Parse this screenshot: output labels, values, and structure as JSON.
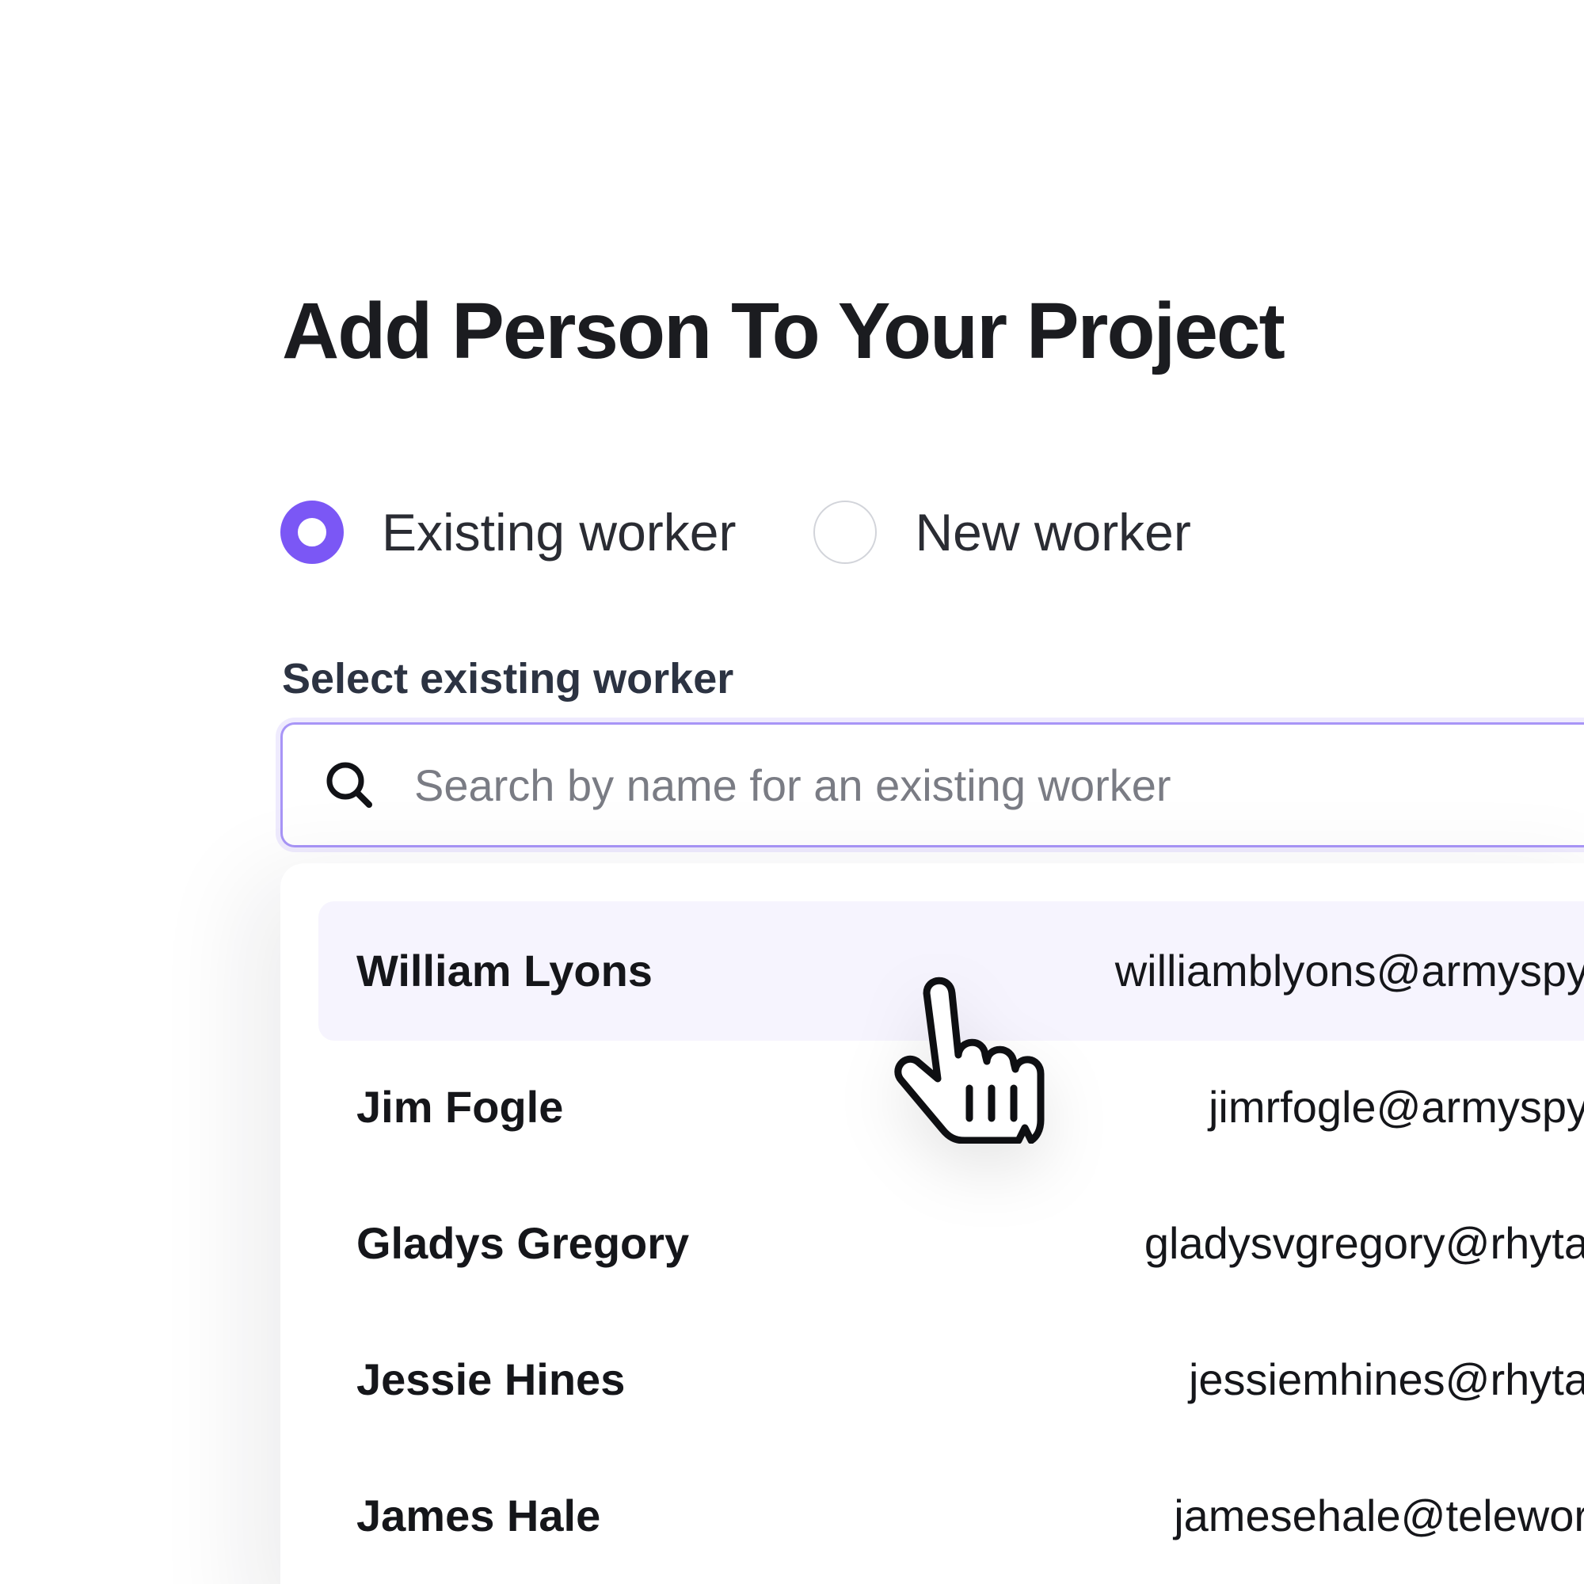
{
  "dialog": {
    "title": "Add Person To Your Project"
  },
  "worker_type": {
    "options": [
      {
        "label": "Existing worker",
        "selected": true
      },
      {
        "label": "New worker",
        "selected": false
      }
    ]
  },
  "search": {
    "label": "Select existing worker",
    "placeholder": "Search by name for an existing worker",
    "value": ""
  },
  "results": [
    {
      "name": "William Lyons",
      "email": "williamblyons@armyspy",
      "highlighted": true
    },
    {
      "name": "Jim Fogle",
      "email": "jimrfogle@armyspy",
      "highlighted": false
    },
    {
      "name": "Gladys Gregory",
      "email": "gladysvgregory@rhyta",
      "highlighted": false
    },
    {
      "name": "Jessie Hines",
      "email": "jessiemhines@rhyta",
      "highlighted": false
    },
    {
      "name": "James Hale",
      "email": "jamesehale@telewor",
      "highlighted": false
    }
  ],
  "colors": {
    "accent": "#7b57f5",
    "highlight_row": "#f6f4fe",
    "label_text": "#2c3342"
  },
  "cursor": {
    "icon": "hand-pointer-icon"
  }
}
